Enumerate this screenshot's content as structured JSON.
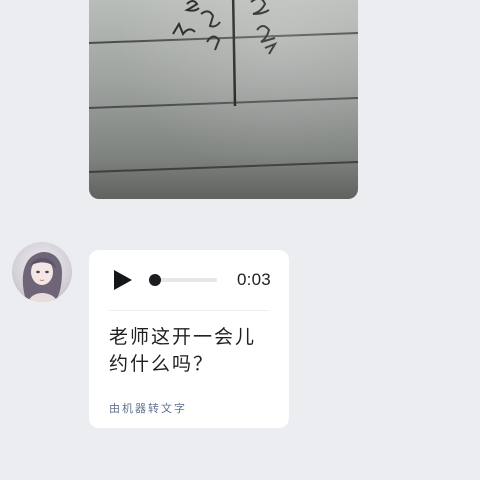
{
  "chat": {
    "photo_message": {
      "icon": "handwritten-notebook-photo"
    },
    "sender": {
      "avatar_icon": "girl-portrait-avatar"
    },
    "voice_message": {
      "duration": "0:03",
      "progress_fraction": 0,
      "transcript": "老师这开一会儿约什么吗？",
      "transcript_note": "由机器转文字",
      "colors": {
        "bubble": "#ffffff",
        "text": "#1f2023",
        "note": "#5f7290",
        "background": "#ebedf0"
      }
    }
  }
}
